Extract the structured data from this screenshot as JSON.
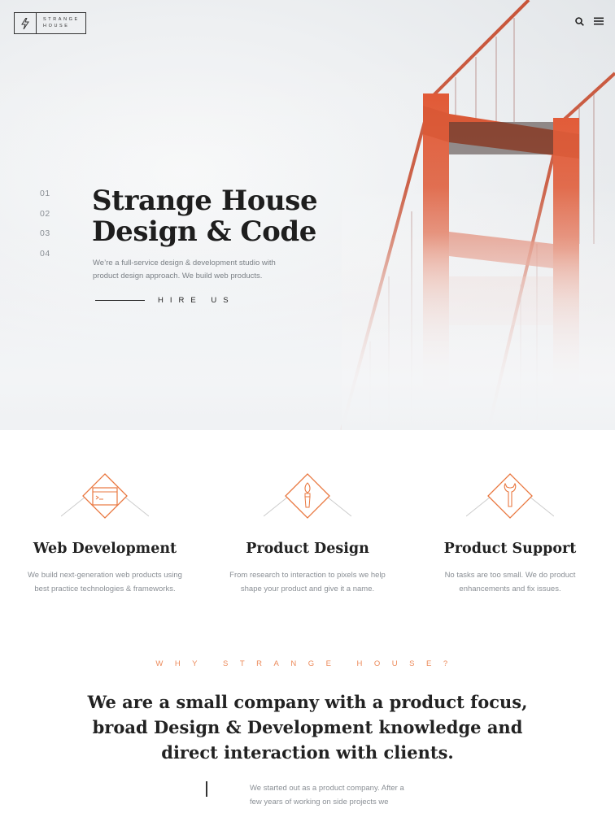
{
  "brand": {
    "line1": "STRANGE",
    "line2": "HOUSE"
  },
  "nav": {
    "search_icon": "search-icon",
    "menu_icon": "hamburger-icon"
  },
  "hero": {
    "slides": [
      "01",
      "02",
      "03",
      "04"
    ],
    "title_line1": "Strange House",
    "title_line2": "Design & Code",
    "subtitle_line1": "We’re a full-service design & development studio with",
    "subtitle_line2": "product design approach. We build web products.",
    "cta": "HIRE US"
  },
  "services": [
    {
      "title": "Web Development",
      "desc_line1": "We build next-generation web products using",
      "desc_line2": "best practice technologies & frameworks.",
      "icon": "browser-window-icon"
    },
    {
      "title": "Product Design",
      "desc_line1": "From research to interaction to pixels we help",
      "desc_line2": "shape your product and give it a name.",
      "icon": "paintbrush-icon"
    },
    {
      "title": "Product Support",
      "desc_line1": "No tasks are too small. We do product",
      "desc_line2": "enhancements and fix issues.",
      "icon": "wrench-icon"
    }
  ],
  "why": {
    "label": "WHY STRANGE HOUSE?",
    "title_line1": "We are a small company with a product focus,",
    "title_line2": "broad Design & Development knowledge and",
    "title_line3": "direct interaction with clients.",
    "body_line1": "We started out as a product company. After a",
    "body_line2": "few years of working on side projects we"
  },
  "colors": {
    "accent": "#ec8a5a",
    "bridge": "#d9502e",
    "text": "#222222",
    "muted": "#8a8f95"
  }
}
